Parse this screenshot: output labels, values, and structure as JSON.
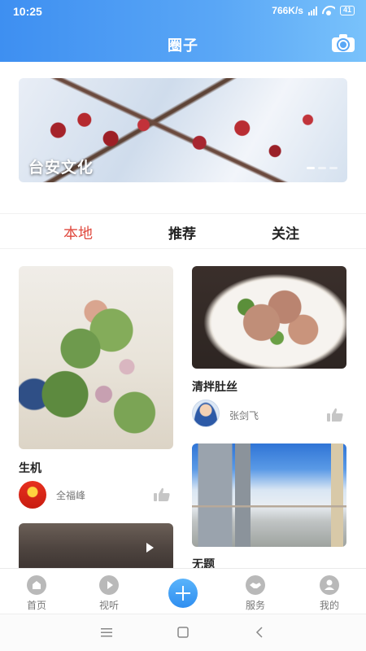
{
  "status_bar": {
    "time": "10:25",
    "network_speed": "766K/s",
    "battery": "41"
  },
  "header": {
    "title": "圈子",
    "camera_icon": "camera-icon"
  },
  "banner": {
    "caption": "台安文化",
    "slides": 3,
    "active_slide": 1
  },
  "tabs": [
    {
      "label": "本地",
      "active": true
    },
    {
      "label": "推荐",
      "active": false
    },
    {
      "label": "关注",
      "active": false
    }
  ],
  "feed": {
    "left": [
      {
        "title": "生机",
        "author": "全福峰"
      },
      {
        "title": "",
        "author": "",
        "is_video": true
      }
    ],
    "right": [
      {
        "title": "清拌肚丝",
        "author": "张剑飞"
      },
      {
        "title": "无题",
        "author": ""
      }
    ]
  },
  "bottom_nav": [
    {
      "label": "首页",
      "icon": "home-icon"
    },
    {
      "label": "视听",
      "icon": "play-icon"
    },
    {
      "label": "",
      "icon": "plus-icon"
    },
    {
      "label": "服务",
      "icon": "handshake-icon"
    },
    {
      "label": "我的",
      "icon": "profile-icon"
    }
  ],
  "colors": {
    "header_start": "#3e8ff1",
    "header_end": "#79c2fb",
    "active_tab": "#e04a3f",
    "plus_button": "#2f8ef0"
  }
}
